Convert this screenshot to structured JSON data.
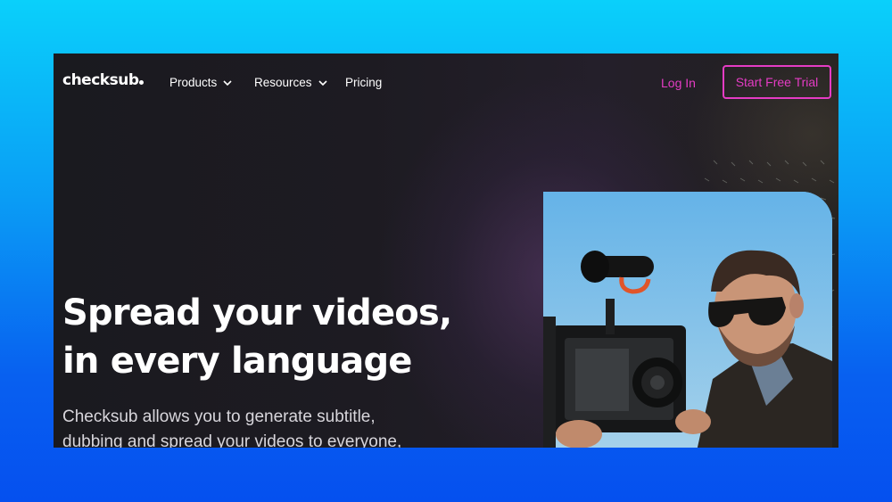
{
  "nav": {
    "logo": "checksub",
    "items": [
      {
        "label": "Products",
        "icon": "chevron-down-icon"
      },
      {
        "label": "Resources",
        "icon": "chevron-down-icon"
      },
      {
        "label": "Pricing"
      }
    ],
    "login_label": "Log In",
    "trial_label": "Start Free Trial"
  },
  "hero": {
    "headline_line1": "Spread your videos,",
    "headline_line2": "in every language",
    "sub_line1": "Checksub allows you to generate subtitle,",
    "sub_line2": "dubbing and spread your videos to everyone,"
  },
  "colors": {
    "background_top": "#0ad0fb",
    "background_bottom": "#0550ef",
    "page": "#1d1b22",
    "accent": "#e53cc4",
    "text": "#ffffff"
  }
}
